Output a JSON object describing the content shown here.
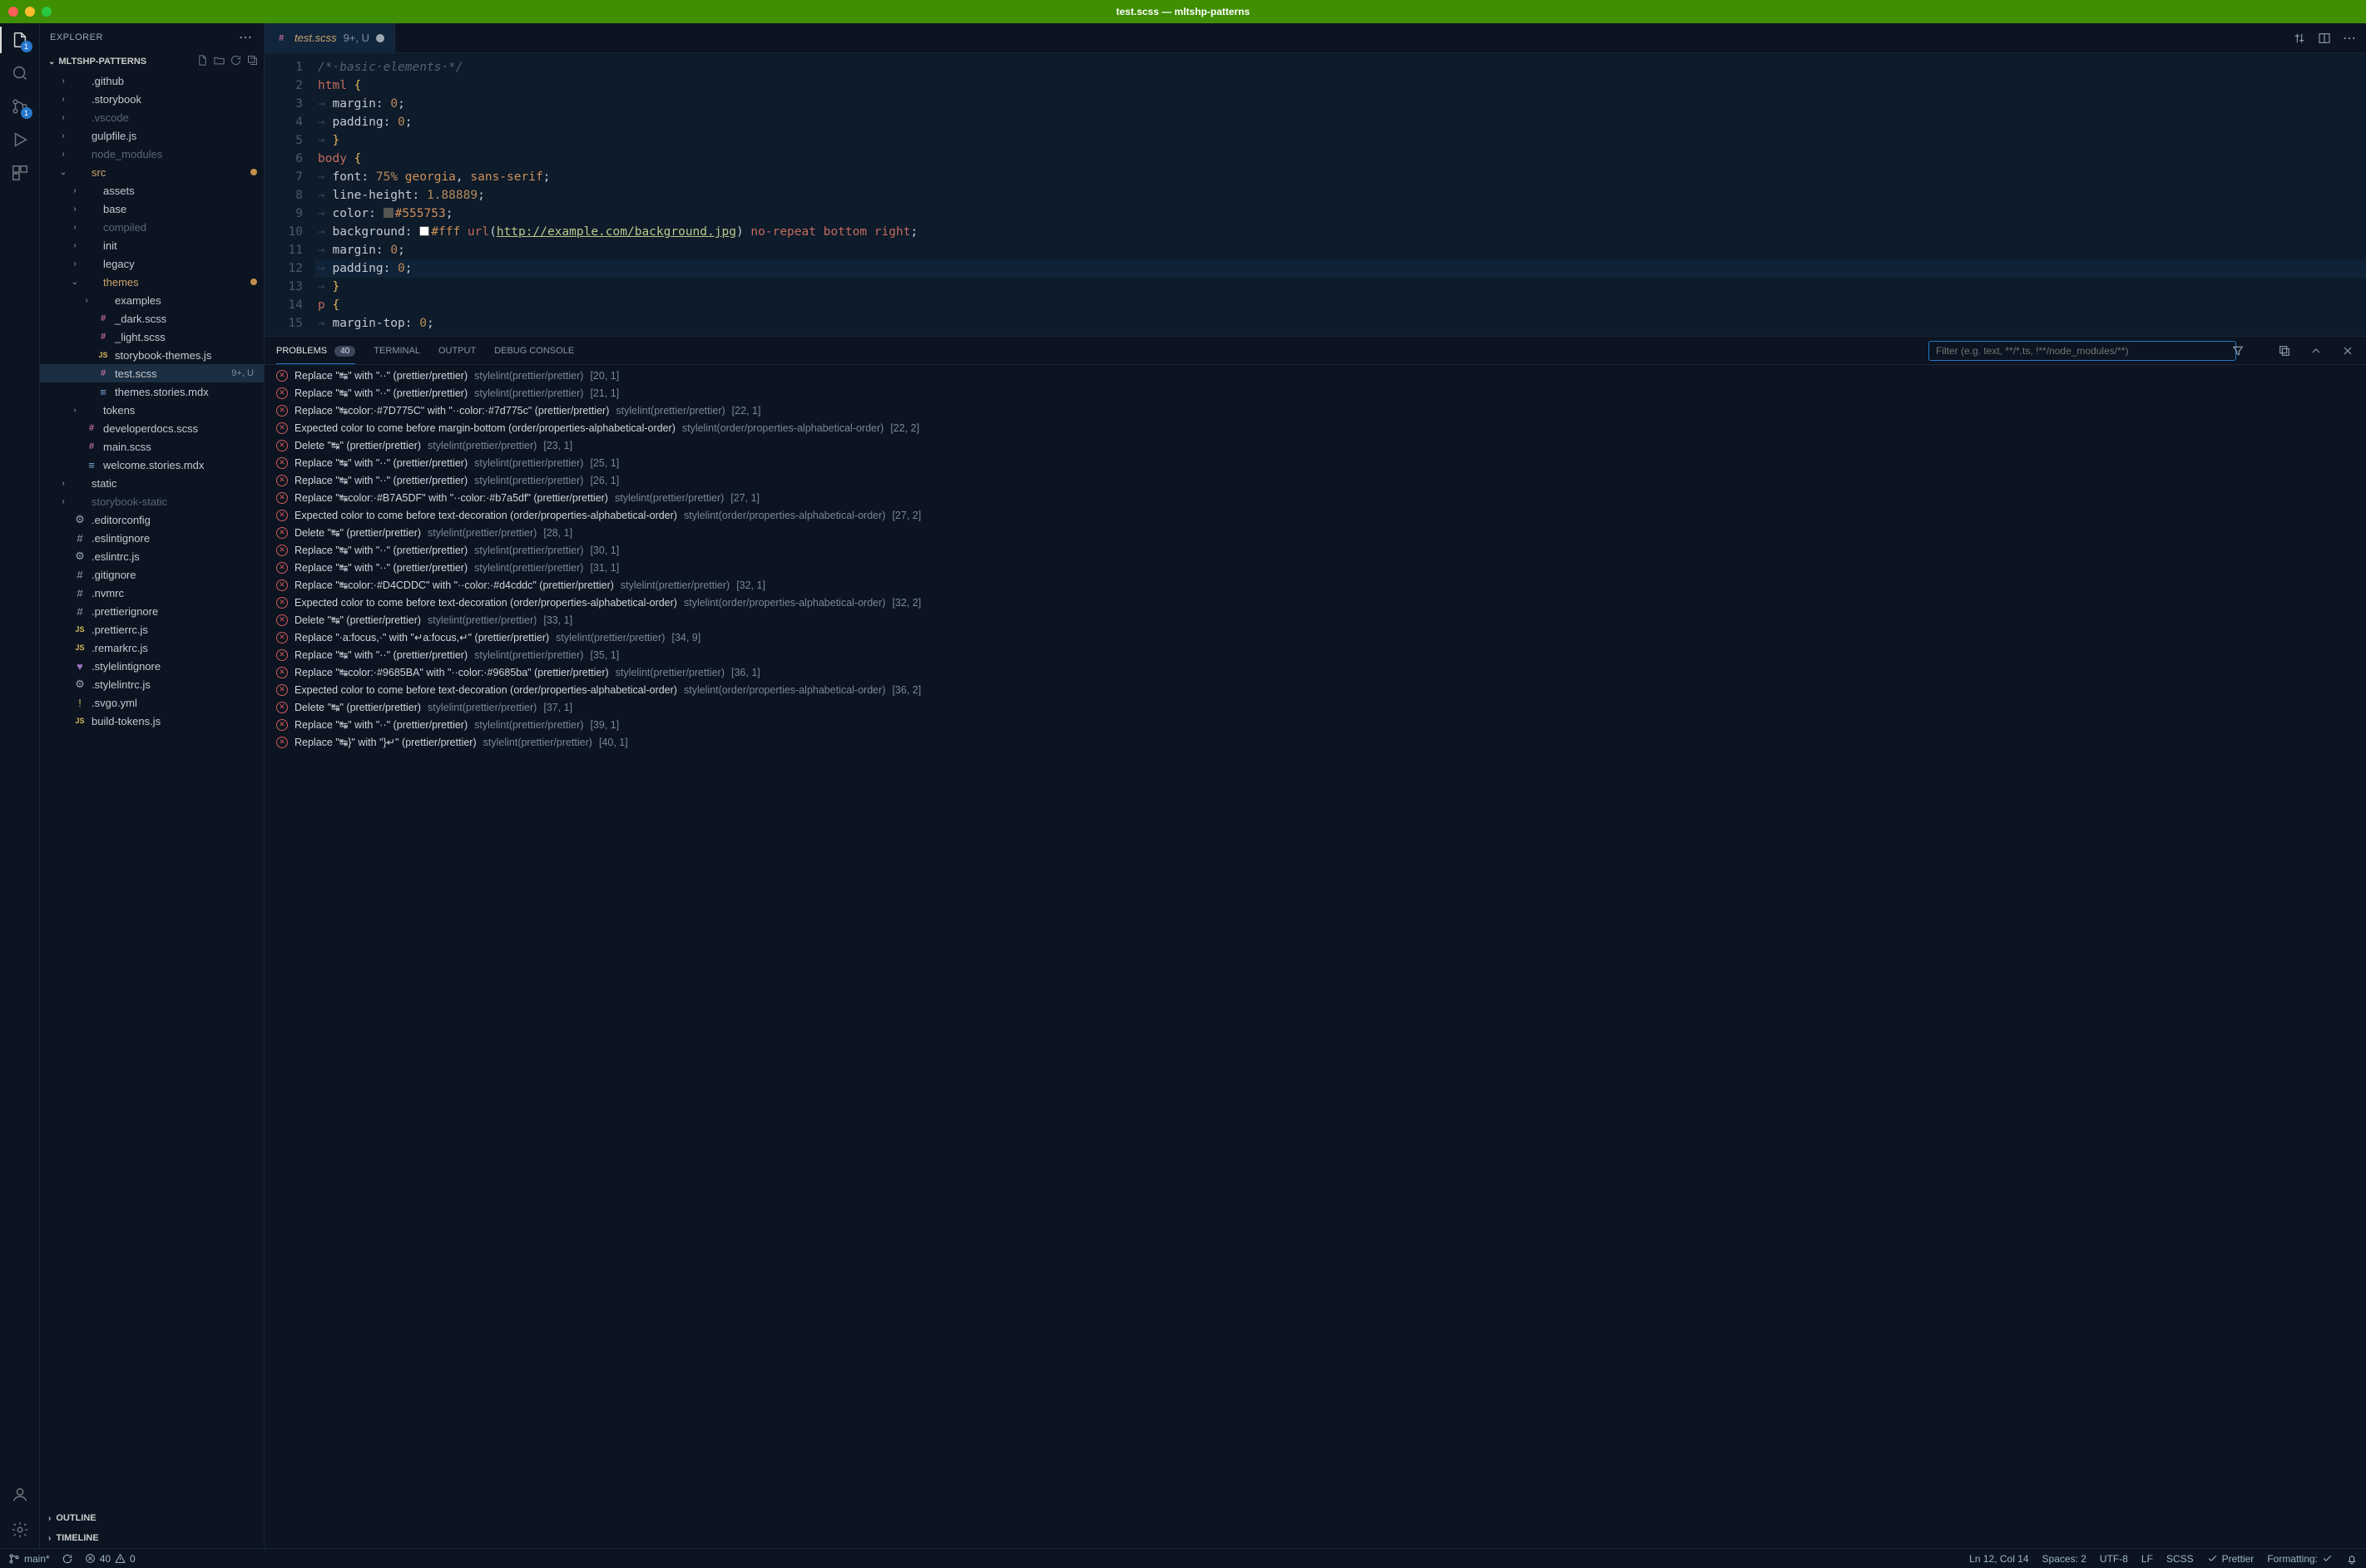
{
  "window_title": "test.scss — mltshp-patterns",
  "activity_badges": {
    "explorer": "1",
    "scm": "1"
  },
  "explorer": {
    "title": "EXPLORER",
    "section": "MLTSHP-PATTERNS",
    "outline": "OUTLINE",
    "timeline": "TIMELINE"
  },
  "tree": [
    {
      "indent": 1,
      "chev": ">",
      "icon": "folder",
      "label": ".github"
    },
    {
      "indent": 1,
      "chev": ">",
      "icon": "folder",
      "label": ".storybook"
    },
    {
      "indent": 1,
      "chev": ">",
      "icon": "folder",
      "label": ".vscode",
      "dim": true
    },
    {
      "indent": 1,
      "chev": ">",
      "icon": "folder",
      "label": "gulpfile.js"
    },
    {
      "indent": 1,
      "chev": ">",
      "icon": "folder",
      "label": "node_modules",
      "dim": true
    },
    {
      "indent": 1,
      "chev": "v",
      "icon": "folder",
      "label": "src",
      "mod": true,
      "dot": true
    },
    {
      "indent": 2,
      "chev": ">",
      "icon": "folder",
      "label": "assets"
    },
    {
      "indent": 2,
      "chev": ">",
      "icon": "folder",
      "label": "base"
    },
    {
      "indent": 2,
      "chev": ">",
      "icon": "folder",
      "label": "compiled",
      "dim": true
    },
    {
      "indent": 2,
      "chev": ">",
      "icon": "folder",
      "label": "init"
    },
    {
      "indent": 2,
      "chev": ">",
      "icon": "folder",
      "label": "legacy"
    },
    {
      "indent": 2,
      "chev": "v",
      "icon": "folder",
      "label": "themes",
      "mod": true,
      "dot": true
    },
    {
      "indent": 3,
      "chev": ">",
      "icon": "folder",
      "label": "examples"
    },
    {
      "indent": 3,
      "chev": "",
      "icon": "scss",
      "label": "_dark.scss"
    },
    {
      "indent": 3,
      "chev": "",
      "icon": "scss",
      "label": "_light.scss"
    },
    {
      "indent": 3,
      "chev": "",
      "icon": "js",
      "label": "storybook-themes.js"
    },
    {
      "indent": 3,
      "chev": "",
      "icon": "scss",
      "label": "test.scss",
      "selected": true,
      "mark": "9+, U"
    },
    {
      "indent": 3,
      "chev": "",
      "icon": "mdx",
      "label": "themes.stories.mdx"
    },
    {
      "indent": 2,
      "chev": ">",
      "icon": "folder",
      "label": "tokens"
    },
    {
      "indent": 2,
      "chev": "",
      "icon": "scss",
      "label": "developerdocs.scss"
    },
    {
      "indent": 2,
      "chev": "",
      "icon": "scss",
      "label": "main.scss"
    },
    {
      "indent": 2,
      "chev": "",
      "icon": "mdx",
      "label": "welcome.stories.mdx"
    },
    {
      "indent": 1,
      "chev": ">",
      "icon": "folder",
      "label": "static"
    },
    {
      "indent": 1,
      "chev": ">",
      "icon": "folder",
      "label": "storybook-static",
      "dim": true
    },
    {
      "indent": 1,
      "chev": "",
      "icon": "gear",
      "label": ".editorconfig"
    },
    {
      "indent": 1,
      "chev": "",
      "icon": "hash",
      "label": ".eslintignore"
    },
    {
      "indent": 1,
      "chev": "",
      "icon": "gear",
      "label": ".eslintrc.js"
    },
    {
      "indent": 1,
      "chev": "",
      "icon": "hash",
      "label": ".gitignore"
    },
    {
      "indent": 1,
      "chev": "",
      "icon": "hash",
      "label": ".nvmrc"
    },
    {
      "indent": 1,
      "chev": "",
      "icon": "hash",
      "label": ".prettierignore"
    },
    {
      "indent": 1,
      "chev": "",
      "icon": "js",
      "label": ".prettierrc.js"
    },
    {
      "indent": 1,
      "chev": "",
      "icon": "js",
      "label": ".remarkrc.js"
    },
    {
      "indent": 1,
      "chev": "",
      "icon": "heart",
      "label": ".stylelintignore"
    },
    {
      "indent": 1,
      "chev": "",
      "icon": "gear",
      "label": ".stylelintrc.js"
    },
    {
      "indent": 1,
      "chev": "",
      "icon": "bang",
      "label": ".svgo.yml"
    },
    {
      "indent": 1,
      "chev": "",
      "icon": "js",
      "label": "build-tokens.js"
    }
  ],
  "tab": {
    "name": "test.scss",
    "status": "9+, U"
  },
  "editor": {
    "lines": [
      {
        "n": 1,
        "html": "<span class='c-comment'>/*·basic·elements·*/</span>"
      },
      {
        "n": 2,
        "html": "<span class='c-tag'>html</span> <span class='c-brace'>{</span>"
      },
      {
        "n": 3,
        "html": "<span class='c-dot'>→ </span><span class='c-prop'>margin</span>: <span class='c-num'>0</span>;"
      },
      {
        "n": 4,
        "html": "<span class='c-dot'>→ </span><span class='c-prop'>padding</span>: <span class='c-num'>0</span>;"
      },
      {
        "n": 5,
        "html": "<span class='c-dot'>→ </span><span class='c-brace'>}</span>"
      },
      {
        "n": 6,
        "html": "<span class='c-tag'>body</span> <span class='c-brace'>{</span>"
      },
      {
        "n": 7,
        "html": "<span class='c-dot'>→ </span><span class='c-prop'>font</span>: <span class='c-num'>75%</span> <span class='c-str'>georgia</span>, <span class='c-str'>sans-serif</span>;"
      },
      {
        "n": 8,
        "html": "<span class='c-dot'>→ </span><span class='c-prop'>line-height</span>: <span class='c-num'>1.88889</span>;"
      },
      {
        "n": 9,
        "html": "<span class='c-dot'>→ </span><span class='c-prop'>color</span>: <span class='colorbox' style='background:#555753'></span><span class='c-str'>#555753</span>;"
      },
      {
        "n": 10,
        "html": "<span class='c-dot'>→ </span><span class='c-prop'>background</span>: <span class='colorbox' style='background:#fff'></span><span class='c-str'>#fff</span> <span class='c-kw'>url</span>(<span class='c-url'>http://example.com/background.jpg</span>) <span class='c-kw'>no-repeat</span> <span class='c-kw'>bottom</span> <span class='c-kw'>right</span>;"
      },
      {
        "n": 11,
        "html": "<span class='c-dot'>→ </span><span class='c-prop'>margin</span>: <span class='c-num'>0</span>;"
      },
      {
        "n": 12,
        "html": "<span class='c-dot'>→ </span><span class='c-prop'>padding</span>: <span class='c-num'>0</span>;",
        "current": true
      },
      {
        "n": 13,
        "html": "<span class='c-dot'>→ </span><span class='c-brace'>}</span>"
      },
      {
        "n": 14,
        "html": "<span class='c-tag'>p</span> <span class='c-brace'>{</span>"
      },
      {
        "n": 15,
        "html": "<span class='c-dot'>→ </span><span class='c-prop'>margin-top</span>: <span class='c-num'>0</span>;"
      }
    ]
  },
  "panel": {
    "tabs": {
      "problems": "PROBLEMS",
      "problems_count": "40",
      "terminal": "TERMINAL",
      "output": "OUTPUT",
      "debug": "DEBUG CONSOLE"
    },
    "filter_placeholder": "Filter (e.g. text, **/*.ts, !**/node_modules/**)",
    "problems": [
      {
        "msg": "Replace \"↹\" with \"··\" (prettier/prettier)",
        "src": "stylelint(prettier/prettier)",
        "loc": "[20, 1]"
      },
      {
        "msg": "Replace \"↹\" with \"··\" (prettier/prettier)",
        "src": "stylelint(prettier/prettier)",
        "loc": "[21, 1]"
      },
      {
        "msg": "Replace \"↹color:·#7D775C\" with \"··color:·#7d775c\" (prettier/prettier)",
        "src": "stylelint(prettier/prettier)",
        "loc": "[22, 1]"
      },
      {
        "msg": "Expected color to come before margin-bottom (order/properties-alphabetical-order)",
        "src": "stylelint(order/properties-alphabetical-order)",
        "loc": "[22, 2]"
      },
      {
        "msg": "Delete \"↹\" (prettier/prettier)",
        "src": "stylelint(prettier/prettier)",
        "loc": "[23, 1]"
      },
      {
        "msg": "Replace \"↹\" with \"··\" (prettier/prettier)",
        "src": "stylelint(prettier/prettier)",
        "loc": "[25, 1]"
      },
      {
        "msg": "Replace \"↹\" with \"··\" (prettier/prettier)",
        "src": "stylelint(prettier/prettier)",
        "loc": "[26, 1]"
      },
      {
        "msg": "Replace \"↹color:·#B7A5DF\" with \"··color:·#b7a5df\" (prettier/prettier)",
        "src": "stylelint(prettier/prettier)",
        "loc": "[27, 1]"
      },
      {
        "msg": "Expected color to come before text-decoration (order/properties-alphabetical-order)",
        "src": "stylelint(order/properties-alphabetical-order)",
        "loc": "[27, 2]"
      },
      {
        "msg": "Delete \"↹\" (prettier/prettier)",
        "src": "stylelint(prettier/prettier)",
        "loc": "[28, 1]"
      },
      {
        "msg": "Replace \"↹\" with \"··\" (prettier/prettier)",
        "src": "stylelint(prettier/prettier)",
        "loc": "[30, 1]"
      },
      {
        "msg": "Replace \"↹\" with \"··\" (prettier/prettier)",
        "src": "stylelint(prettier/prettier)",
        "loc": "[31, 1]"
      },
      {
        "msg": "Replace \"↹color:·#D4CDDC\" with \"··color:·#d4cddc\" (prettier/prettier)",
        "src": "stylelint(prettier/prettier)",
        "loc": "[32, 1]"
      },
      {
        "msg": "Expected color to come before text-decoration (order/properties-alphabetical-order)",
        "src": "stylelint(order/properties-alphabetical-order)",
        "loc": "[32, 2]"
      },
      {
        "msg": "Delete \"↹\" (prettier/prettier)",
        "src": "stylelint(prettier/prettier)",
        "loc": "[33, 1]"
      },
      {
        "msg": "Replace \"·a:focus,·\" with \"↵a:focus,↵\" (prettier/prettier)",
        "src": "stylelint(prettier/prettier)",
        "loc": "[34, 9]"
      },
      {
        "msg": "Replace \"↹\" with \"··\" (prettier/prettier)",
        "src": "stylelint(prettier/prettier)",
        "loc": "[35, 1]"
      },
      {
        "msg": "Replace \"↹color:·#9685BA\" with \"··color:·#9685ba\" (prettier/prettier)",
        "src": "stylelint(prettier/prettier)",
        "loc": "[36, 1]"
      },
      {
        "msg": "Expected color to come before text-decoration (order/properties-alphabetical-order)",
        "src": "stylelint(order/properties-alphabetical-order)",
        "loc": "[36, 2]"
      },
      {
        "msg": "Delete \"↹\" (prettier/prettier)",
        "src": "stylelint(prettier/prettier)",
        "loc": "[37, 1]"
      },
      {
        "msg": "Replace \"↹\" with \"··\" (prettier/prettier)",
        "src": "stylelint(prettier/prettier)",
        "loc": "[39, 1]"
      },
      {
        "msg": "Replace \"↹}\" with \"}↵\" (prettier/prettier)",
        "src": "stylelint(prettier/prettier)",
        "loc": "[40, 1]"
      }
    ]
  },
  "statusbar": {
    "branch": "main*",
    "errors": "40",
    "warnings": "0",
    "cursor": "Ln 12, Col 14",
    "spaces": "Spaces: 2",
    "encoding": "UTF-8",
    "eol": "LF",
    "lang": "SCSS",
    "prettier": "Prettier",
    "formatting": "Formatting:"
  }
}
